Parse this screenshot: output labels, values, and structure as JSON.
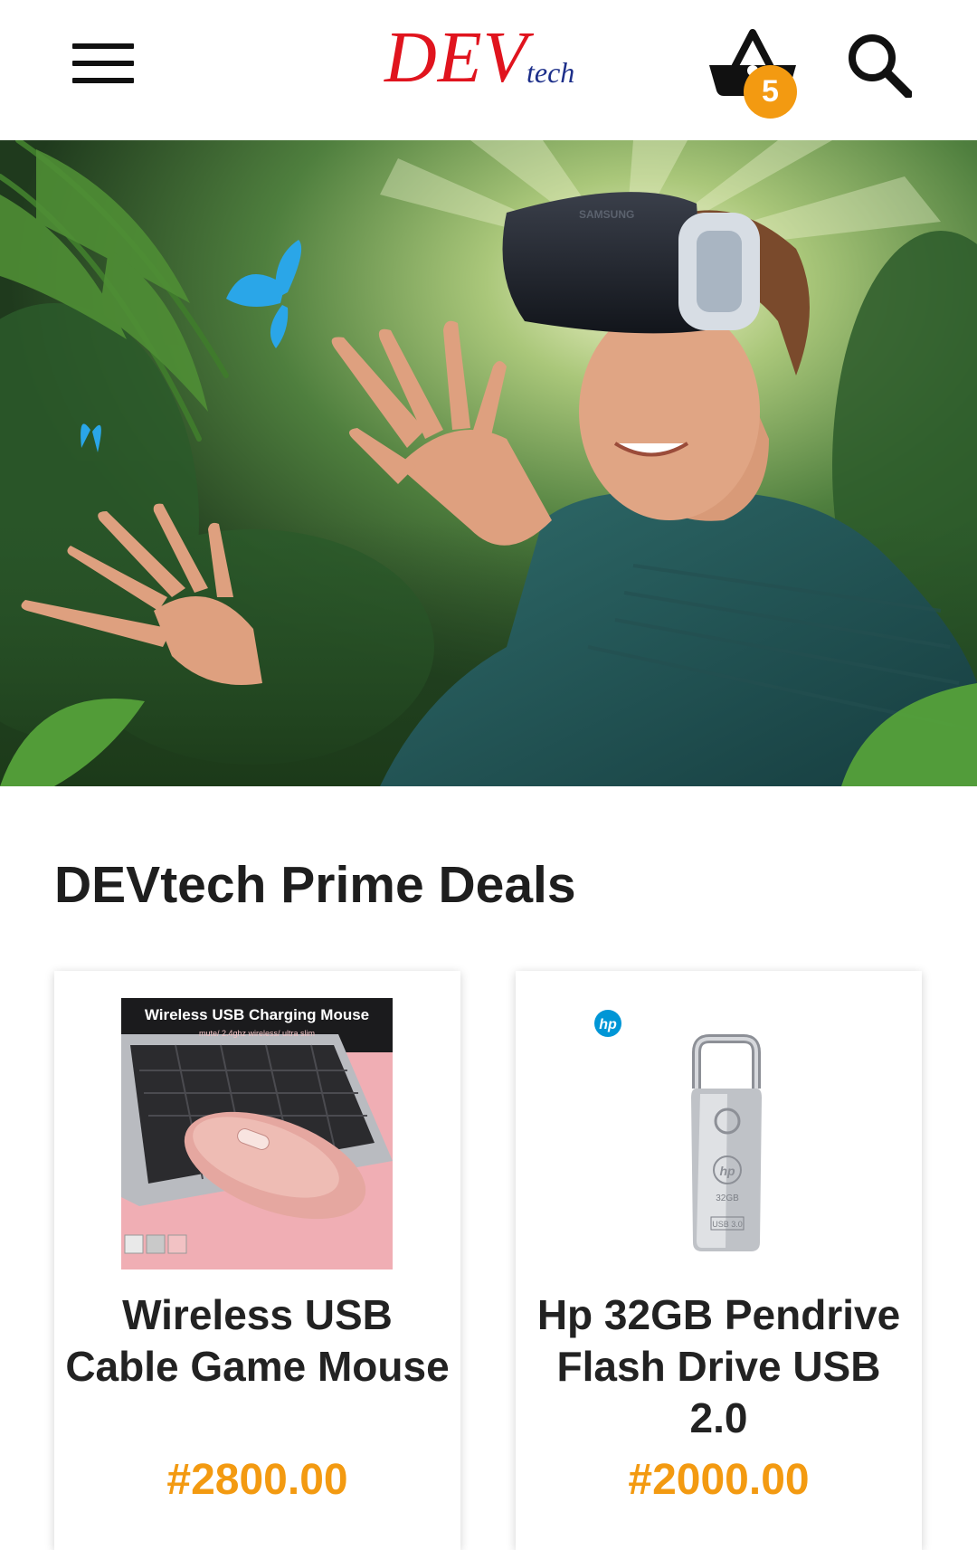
{
  "header": {
    "logo_main": "DEV",
    "logo_sub": "tech",
    "cart_count": "5"
  },
  "hero": {
    "vr_headset_brand": "SAMSUNG"
  },
  "section": {
    "title": "DEVtech Prime Deals"
  },
  "products": [
    {
      "name": "Wireless USB Cable Game Mouse",
      "price": "#2800.00",
      "image_title": "Wireless USB Charging Mouse",
      "image_subtitle": "mute/ 2.4ghz wireless/ ultra slim"
    },
    {
      "name": "Hp 32GB Pendrive Flash Drive USB 2.0",
      "price": "#2000.00",
      "image_logo": "hp",
      "image_capacity": "32GB",
      "image_usb": "USB 3.0"
    }
  ],
  "colors": {
    "brand_red": "#e0141e",
    "brand_navy": "#1d2f8a",
    "accent_orange": "#f39a11"
  }
}
